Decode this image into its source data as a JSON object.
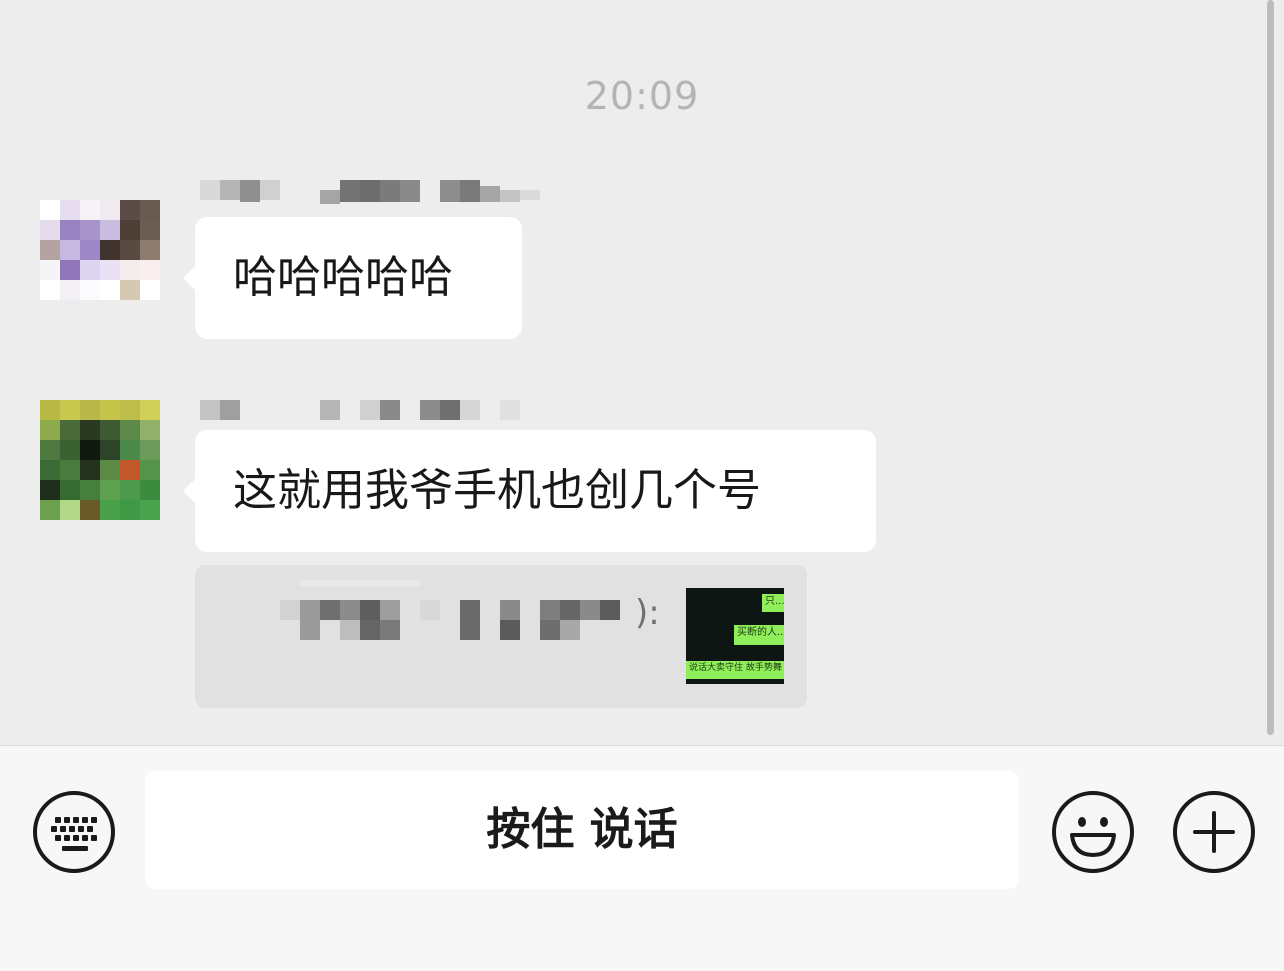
{
  "chat": {
    "timestamp": "20:09",
    "messages": [
      {
        "sender": "",
        "text": "哈哈哈哈哈"
      },
      {
        "sender": "",
        "text": "这就用我爷手机也创几个号"
      }
    ],
    "quote": {
      "colon": "):",
      "thumb_lines": [
        "只...",
        "买断的人...",
        "说话大卖守住 故手势舞"
      ]
    }
  },
  "input_bar": {
    "hold_to_talk_label": "按住 说话",
    "icons": {
      "keyboard": "keyboard-icon",
      "emoji": "smiley-icon",
      "plus": "plus-icon"
    }
  },
  "colors": {
    "background": "#ededed",
    "bubble": "#ffffff",
    "quote_bg": "#e1e1e1",
    "input_bar_bg": "#f7f7f7",
    "thumb_green": "#90ee5a"
  }
}
